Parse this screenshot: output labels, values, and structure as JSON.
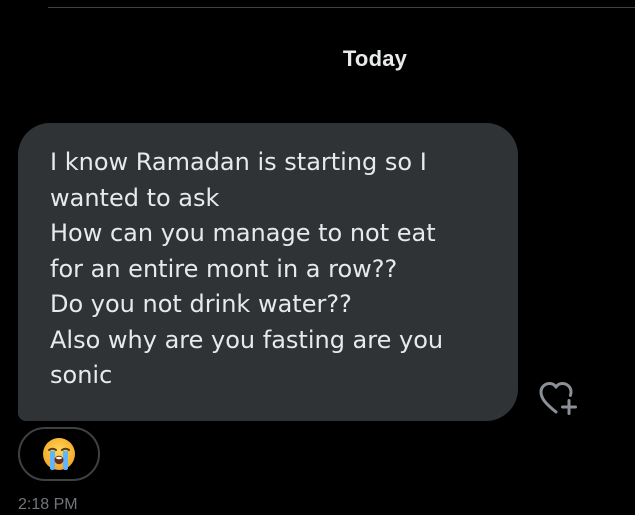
{
  "date_separator": "Today",
  "message": {
    "text": "I know Ramadan is starting so I\nwanted to ask\nHow can you manage to not eat\nfor an entire mont in a row??\nDo you not drink water??\nAlso why are you fasting are you\nsonic",
    "timestamp": "2:18 PM",
    "reaction_emoji_icon": "loudly-crying-face-icon",
    "add_reaction_icon": "heart-plus-icon"
  },
  "colors": {
    "background": "#000000",
    "bubble": "#2f3336",
    "text": "#e7e9ea",
    "muted": "#71767b",
    "border": "#3e4144"
  }
}
